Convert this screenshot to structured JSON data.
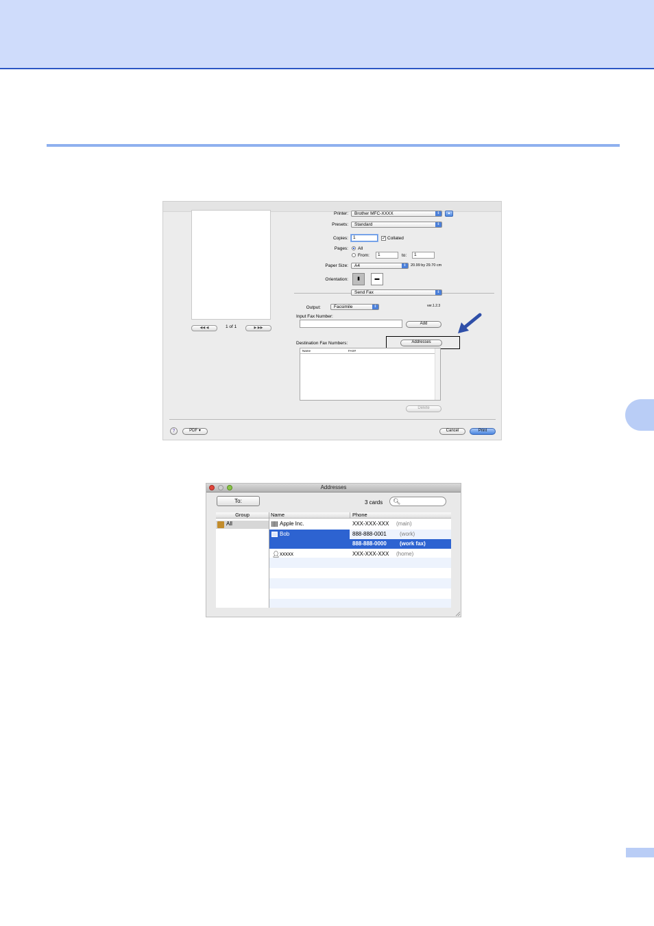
{
  "print_dialog": {
    "printer_label": "Printer:",
    "printer_value": "Brother MFC-XXXX",
    "presets_label": "Presets:",
    "presets_value": "Standard",
    "copies_label": "Copies:",
    "copies_value": "1",
    "collated_label": "Collated",
    "pages_label": "Pages:",
    "pages_all": "All",
    "pages_from": "From:",
    "pages_from_value": "1",
    "pages_to": "to:",
    "pages_to_value": "1",
    "paper_label": "Paper Size:",
    "paper_value": "A4",
    "paper_dims": "20.99 by 29.70 cm",
    "orientation_label": "Orientation:",
    "section_value": "Send Fax",
    "output_label": "Output:",
    "output_value": "Facsimile",
    "version": "ver.1.2.3",
    "input_fax_label": "Input Fax Number:",
    "add_button": "Add",
    "addresses_button": "Addresses",
    "destination_label": "Destination Fax Numbers:",
    "col_name": "Name",
    "col_fax": "FAX#",
    "delete_button": "Delete",
    "page_count": "1 of 1",
    "pdf_button": "PDF ▾",
    "cancel_button": "Cancel",
    "print_button": "Print",
    "help_icon": "?"
  },
  "addresses": {
    "title": "Addresses",
    "to_button": "To:",
    "card_count": "3 cards",
    "col_group": "Group",
    "col_name": "Name",
    "col_phone": "Phone",
    "group_all": "All",
    "entries": [
      {
        "name": "Apple Inc.",
        "phone": "XXX-XXX-XXX",
        "type": "(main)"
      },
      {
        "name": "Bob",
        "phone": "888-888-0001",
        "type": "(work)"
      },
      {
        "name": "",
        "phone": "888-888-0000",
        "type": "(work fax)"
      },
      {
        "name": "xxxxx",
        "phone": "XXX-XXX-XXX",
        "type": "(home)"
      }
    ]
  },
  "colors": {
    "header_band": "#cfdcfb",
    "header_line": "#2b56c4",
    "selection": "#2d63d1",
    "arrow": "#2f4fa8"
  }
}
